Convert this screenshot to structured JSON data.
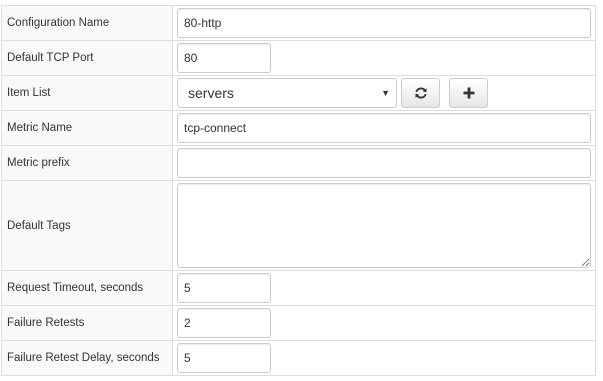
{
  "form": {
    "config_name": {
      "label": "Configuration Name",
      "value": "80-http"
    },
    "tcp_port": {
      "label": "Default TCP Port",
      "value": "80"
    },
    "item_list": {
      "label": "Item List",
      "selected": "servers",
      "caret": "▼"
    },
    "metric_name": {
      "label": "Metric Name",
      "value": "tcp-connect"
    },
    "metric_prefix": {
      "label": "Metric prefix",
      "value": ""
    },
    "default_tags": {
      "label": "Default Tags",
      "value": ""
    },
    "request_timeout": {
      "label": "Request Timeout, seconds",
      "value": "5"
    },
    "failure_retests": {
      "label": "Failure Retests",
      "value": "2"
    },
    "failure_retest_delay": {
      "label": "Failure Retest Delay, seconds",
      "value": "5"
    }
  },
  "icons": {
    "refresh": "refresh-icon",
    "add": "plus-icon"
  }
}
